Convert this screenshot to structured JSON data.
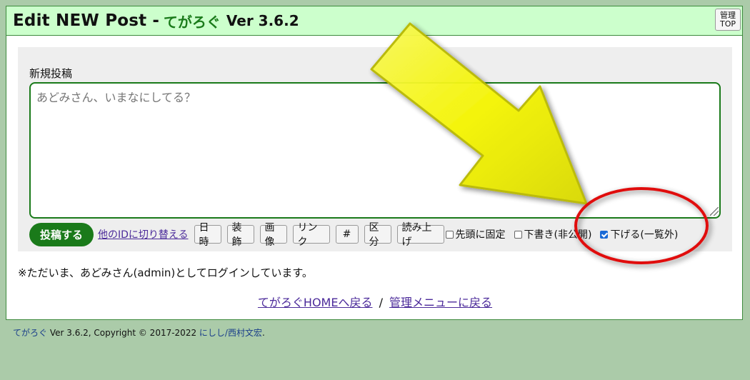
{
  "header": {
    "title": "Edit NEW Post",
    "separator": "-",
    "app_name": "てがろぐ",
    "version": "Ver 3.6.2",
    "admin_button_line1": "管理",
    "admin_button_line2": "TOP"
  },
  "form": {
    "section_label": "新規投稿",
    "textarea_placeholder": "あどみさん、いまなにしてる？",
    "submit_label": "投稿する",
    "switch_id_link": "他のIDに切り替える",
    "tools": [
      "日時",
      "装飾",
      "画像",
      "リンク",
      "#",
      "区分",
      "読み上げ"
    ],
    "checkboxes": [
      {
        "label": "先頭に固定",
        "checked": false
      },
      {
        "label": "下書き(非公開)",
        "checked": false
      },
      {
        "label": "下げる(一覧外)",
        "checked": true
      }
    ]
  },
  "login_message": "※ただいま、あどみさん(admin)としてログインしています。",
  "nav": {
    "home_link": "てがろぐHOMEへ戻る",
    "separator": "/",
    "admin_menu_link": "管理メニューに戻る"
  },
  "footer": {
    "app_link": "てがろぐ",
    "version_copyright": "Ver 3.6.2, Copyright © 2017-2022",
    "author_link": "にしし/西村文宏",
    "end": "."
  },
  "colors": {
    "page_bg": "#abcba9",
    "title_bg": "#ccffcc",
    "accent_green": "#1a7a1a",
    "arrow_yellow": "#f4f400",
    "circle_red": "#e01010"
  }
}
